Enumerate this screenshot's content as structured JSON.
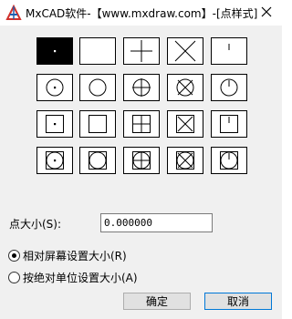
{
  "window": {
    "title": "MxCAD软件-【www.mxdraw.com】-[点样式]",
    "close_glyph": "✕"
  },
  "point_styles": {
    "selected_index": 0,
    "rows": [
      [
        "dot-selected",
        "blank",
        "plus",
        "cross",
        "tick"
      ],
      [
        "circle-dot",
        "circle",
        "circle-plus",
        "circle-cross",
        "circle-tick"
      ],
      [
        "square-dot",
        "square",
        "square-plus",
        "square-cross",
        "square-tick"
      ],
      [
        "square-circle-dot",
        "square-circle",
        "square-circle-plus",
        "square-circle-cross",
        "square-circle-tick"
      ]
    ]
  },
  "size": {
    "label": "点大小(S):",
    "value": "0.000000"
  },
  "mode": {
    "relative_label": "相对屏幕设置大小(R)",
    "absolute_label": "按绝对单位设置大小(A)",
    "selected": "relative"
  },
  "buttons": {
    "ok_label": "确定",
    "cancel_label": "取消"
  }
}
